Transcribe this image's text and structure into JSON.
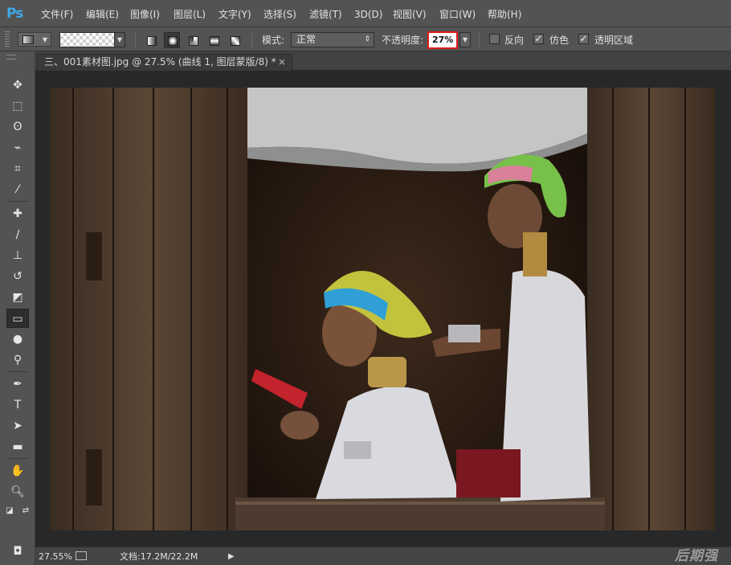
{
  "app": {
    "logo": "Ps",
    "menu": [
      "文件(F)",
      "编辑(E)",
      "图像(I)",
      "图层(L)",
      "文字(Y)",
      "选择(S)",
      "滤镜(T)",
      "3D(D)",
      "视图(V)",
      "窗口(W)",
      "帮助(H)"
    ]
  },
  "options_bar": {
    "gradient_types": [
      "linear-gradient-icon",
      "radial-gradient-icon",
      "angle-gradient-icon",
      "reflected-gradient-icon",
      "diamond-gradient-icon"
    ],
    "selected_gradient_type": "radial-gradient-icon",
    "mode_label": "模式:",
    "mode_value": "正常",
    "opacity_label": "不透明度:",
    "opacity_value": "27%",
    "reverse_label": "反向",
    "reverse_checked": false,
    "dither_label": "仿色",
    "dither_checked": true,
    "transparency_label": "透明区域",
    "transparency_checked": true,
    "highlight_color": "#e01a1a"
  },
  "document": {
    "tab_title": "三、001素材图.jpg @ 27.5% (曲线 1, 图层蒙版/8) *",
    "close_glyph": "×"
  },
  "toolbar": {
    "active_tool": "gradient-tool-icon",
    "tools": [
      "move-tool-icon",
      "marquee-tool-icon",
      "lasso-tool-icon",
      "quick-select-tool-icon",
      "crop-tool-icon",
      "eyedropper-tool-icon",
      "healing-brush-tool-icon",
      "brush-tool-icon",
      "clone-stamp-tool-icon",
      "history-brush-tool-icon",
      "eraser-tool-icon",
      "gradient-tool-icon",
      "blur-tool-icon",
      "dodge-tool-icon",
      "pen-tool-icon",
      "type-tool-icon",
      "path-select-tool-icon",
      "rectangle-tool-icon",
      "hand-tool-icon",
      "zoom-tool-icon"
    ],
    "foreground_color": "#000000",
    "background_color": "#ffffff"
  },
  "status": {
    "zoom": "27.55%",
    "doc_info": "文档:17.2M/22.2M",
    "watermark": "后期强"
  }
}
